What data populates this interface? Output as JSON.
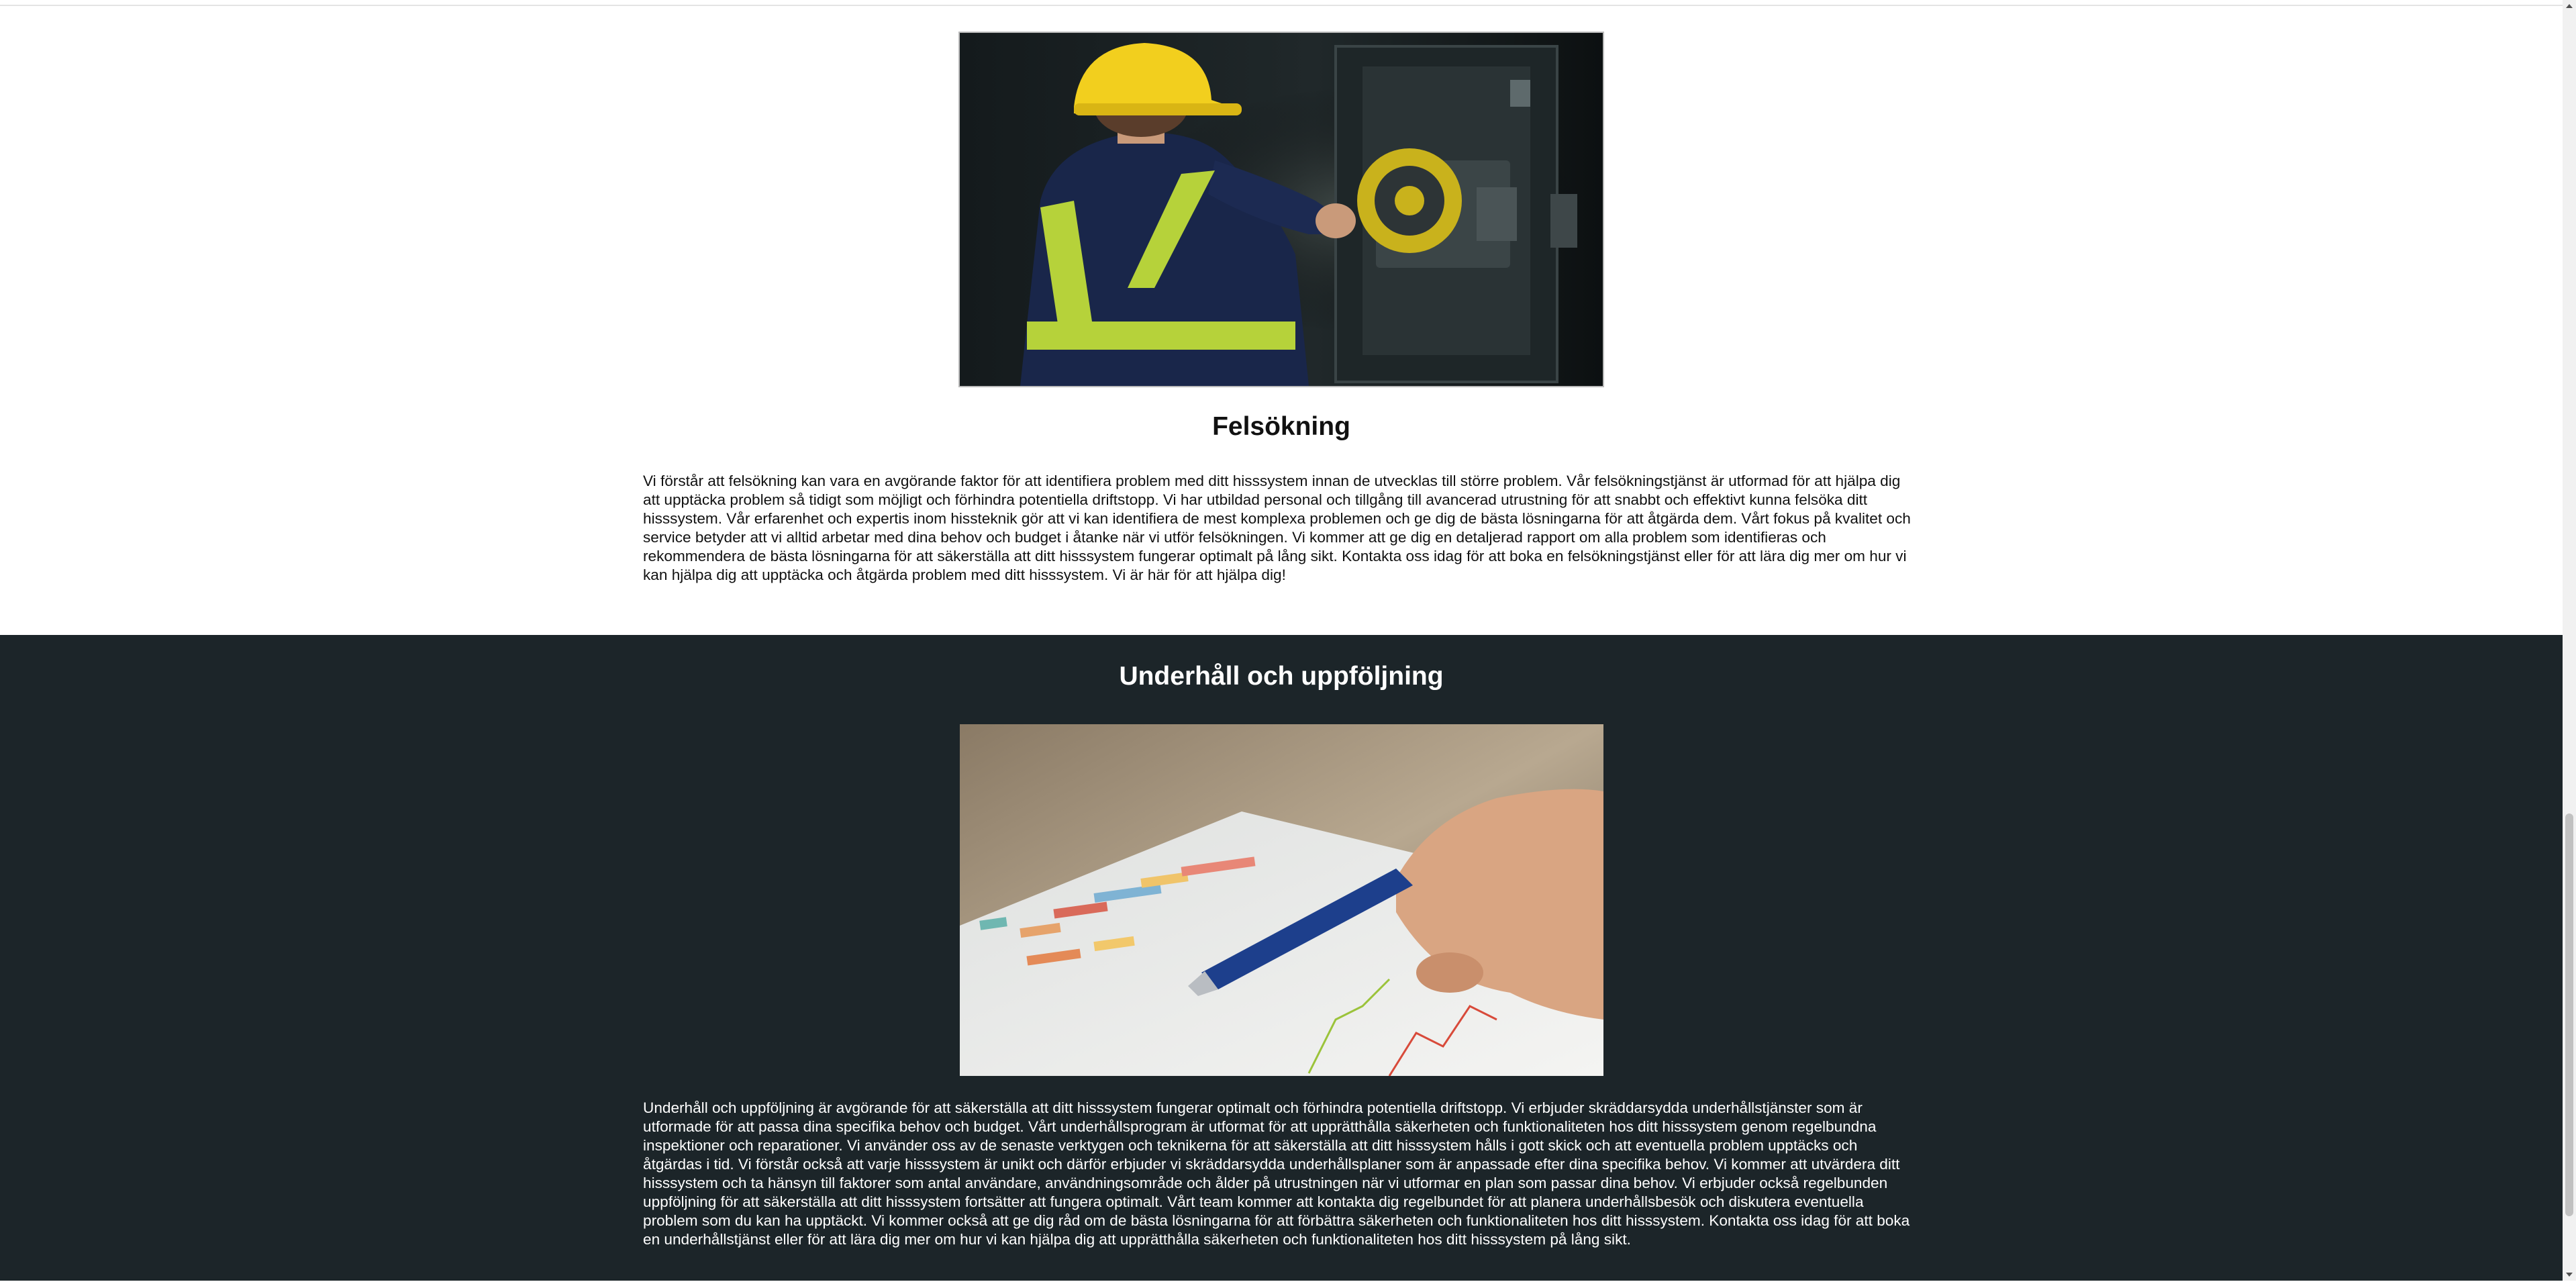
{
  "sections": [
    {
      "heading": "Felsökning",
      "image_alt": "technician inspecting elevator machinery",
      "text": "Vi förstår att felsökning kan vara en avgörande faktor för att identifiera problem med ditt hisssystem innan de utvecklas till större problem. Vår felsökningstjänst är utformad för att hjälpa dig att upptäcka problem så tidigt som möjligt och förhindra potentiella driftstopp. Vi har utbildad personal och tillgång till avancerad utrustning för att snabbt och effektivt kunna felsöka ditt hisssystem. Vår erfarenhet och expertis inom hissteknik gör att vi kan identifiera de mest komplexa problemen och ge dig de bästa lösningarna för att åtgärda dem. Vårt fokus på kvalitet och service betyder att vi alltid arbetar med dina behov och budget i åtanke när vi utför felsökningen. Vi kommer att ge dig en detaljerad rapport om alla problem som identifieras och rekommendera de bästa lösningarna för att säkerställa att ditt hisssystem fungerar optimalt på lång sikt. Kontakta oss idag för att boka en felsökningstjänst eller för att lära dig mer om hur vi kan hjälpa dig att upptäcka och åtgärda problem med ditt hisssystem. Vi är här för att hjälpa dig!"
    },
    {
      "heading": "Underhåll och uppföljning",
      "image_alt": "hand with pen reviewing charts",
      "text": "Underhåll och uppföljning är avgörande för att säkerställa att ditt hisssystem fungerar optimalt och förhindra potentiella driftstopp. Vi erbjuder skräddarsydda underhållstjänster som är utformade för att passa dina specifika behov och budget. Vårt underhållsprogram är utformat för att upprätthålla säkerheten och funktionaliteten hos ditt hisssystem genom regelbundna inspektioner och reparationer. Vi använder oss av de senaste verktygen och teknikerna för att säkerställa att ditt hisssystem hålls i gott skick och att eventuella problem upptäcks och åtgärdas i tid. Vi förstår också att varje hisssystem är unikt och därför erbjuder vi skräddarsydda underhållsplaner som är anpassade efter dina specifika behov. Vi kommer att utvärdera ditt hisssystem och ta hänsyn till faktorer som antal användare, användningsområde och ålder på utrustningen när vi utformar en plan som passar dina behov. Vi erbjuder också regelbunden uppföljning för att säkerställa att ditt hisssystem fortsätter att fungera optimalt. Vårt team kommer att kontakta dig regelbundet för att planera underhållsbesök och diskutera eventuella problem som du kan ha upptäckt. Vi kommer också att ge dig råd om de bästa lösningarna för att förbättra säkerheten och funktionaliteten hos ditt hisssystem. Kontakta oss idag för att boka en underhållstjänst eller för att lära dig mer om hur vi kan hjälpa dig att upprätthålla säkerheten och funktionaliteten hos ditt hisssystem på lång sikt."
    }
  ],
  "colors": {
    "light_bg": "#ffffff",
    "dark_bg": "#1c2529",
    "dark_text": "#111111",
    "light_text": "#ffffff"
  }
}
